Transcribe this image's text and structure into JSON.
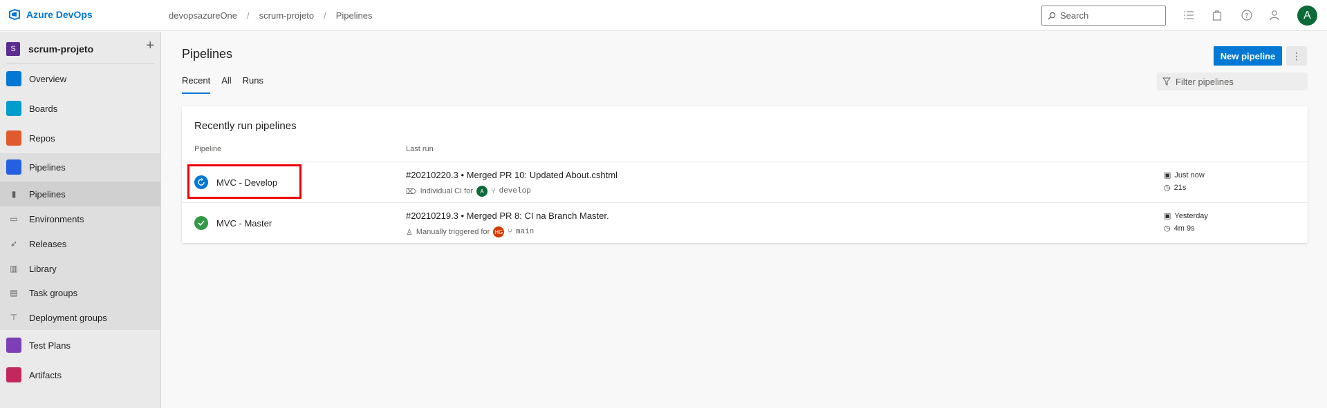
{
  "header": {
    "brand": "Azure DevOps",
    "breadcrumbs": [
      "devopsazureOne",
      "scrum-projeto",
      "Pipelines"
    ],
    "breadcrumb_sep": "/",
    "search_placeholder": "Search",
    "avatar_initial": "A"
  },
  "sidebar": {
    "project_initial": "S",
    "project_name": "scrum-projeto",
    "add_label": "+",
    "items": [
      {
        "label": "Overview",
        "icon": "overview-icon",
        "color": "#0078d4"
      },
      {
        "label": "Boards",
        "icon": "boards-icon",
        "color": "#009ccc"
      },
      {
        "label": "Repos",
        "icon": "repos-icon",
        "color": "#e05a2e"
      },
      {
        "label": "Pipelines",
        "icon": "pipelines-icon",
        "color": "#2560e0"
      },
      {
        "label": "Test Plans",
        "icon": "test-plans-icon",
        "color": "#7c3fb5"
      },
      {
        "label": "Artifacts",
        "icon": "artifacts-icon",
        "color": "#c2285e"
      }
    ],
    "sub_items": [
      {
        "label": "Pipelines",
        "icon": "pipelines-sub-icon",
        "active": true
      },
      {
        "label": "Environments",
        "icon": "environments-icon"
      },
      {
        "label": "Releases",
        "icon": "releases-icon"
      },
      {
        "label": "Library",
        "icon": "library-icon"
      },
      {
        "label": "Task groups",
        "icon": "task-groups-icon"
      },
      {
        "label": "Deployment groups",
        "icon": "deployment-groups-icon"
      }
    ]
  },
  "main": {
    "title": "Pipelines",
    "tabs": [
      {
        "label": "Recent",
        "active": true
      },
      {
        "label": "All"
      },
      {
        "label": "Runs"
      }
    ],
    "new_button": "New pipeline",
    "more_label": "⋮",
    "filter_placeholder": "Filter pipelines",
    "card": {
      "title": "Recently run pipelines",
      "col_pipeline": "Pipeline",
      "col_last_run": "Last run",
      "rows": [
        {
          "name": "MVC - Develop",
          "status": "running",
          "status_color": "#0078d4",
          "run_title": "#20210220.3 • Merged PR 10: Updated About.cshtml",
          "trigger": "Individual CI for",
          "user_initial": "A",
          "user_color": "#0b6a38",
          "branch": "develop",
          "when": "Just now",
          "duration": "21s"
        },
        {
          "name": "MVC - Master",
          "status": "succeeded",
          "status_color": "#339947",
          "run_title": "#20210219.3 • Merged PR 8: CI na Branch Master.",
          "trigger": "Manually triggered for",
          "user_initial": "HG",
          "user_color": "#d83b01",
          "branch": "main",
          "when": "Yesterday",
          "duration": "4m 9s"
        }
      ]
    }
  }
}
